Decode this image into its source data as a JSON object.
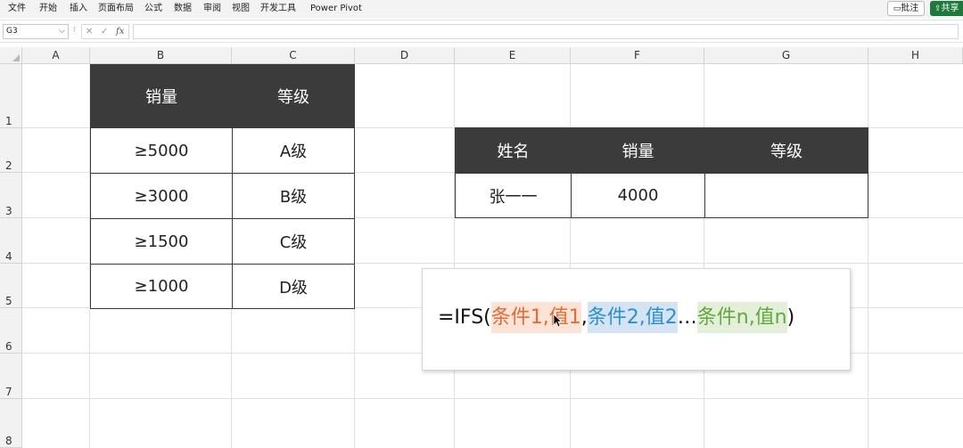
{
  "menu": [
    "文件",
    "开始",
    "插入",
    "页面布局",
    "公式",
    "数据",
    "审阅",
    "视图",
    "开发工具",
    "Power Pivot"
  ],
  "buttons": {
    "comment": "批注",
    "share": "共享"
  },
  "formula_bar": {
    "name_box": "G3",
    "formula": ""
  },
  "columns": [
    "A",
    "B",
    "C",
    "D",
    "E",
    "F",
    "G",
    "H"
  ],
  "rows": [
    "1",
    "2",
    "3",
    "4",
    "5",
    "6",
    "7",
    "8"
  ],
  "grade_table": {
    "headers": [
      "销量",
      "等级"
    ],
    "rows": [
      [
        "≥5000",
        "A级"
      ],
      [
        "≥3000",
        "B级"
      ],
      [
        "≥1500",
        "C级"
      ],
      [
        "≥1000",
        "D级"
      ]
    ]
  },
  "lookup_table": {
    "headers": [
      "姓名",
      "销量",
      "等级"
    ],
    "row": [
      "张一一",
      "4000",
      ""
    ]
  },
  "formula_callout": {
    "prefix": "=IFS(",
    "seg1": "条件1,值1",
    "sep1": ",",
    "seg2": "条件2,值2",
    "ellipsis": "…",
    "seg3": "条件n,值n",
    "suffix": ")"
  },
  "colors": {
    "header_fill": "#3b3b3b",
    "seg1_bg": "#fbe3d6",
    "seg1_fg": "#e26b38",
    "seg2_bg": "#d5e4f2",
    "seg2_fg": "#2e8ed0",
    "seg3_bg": "#e3efd9",
    "seg3_fg": "#62a83e",
    "share_button": "#1e7a3c"
  }
}
